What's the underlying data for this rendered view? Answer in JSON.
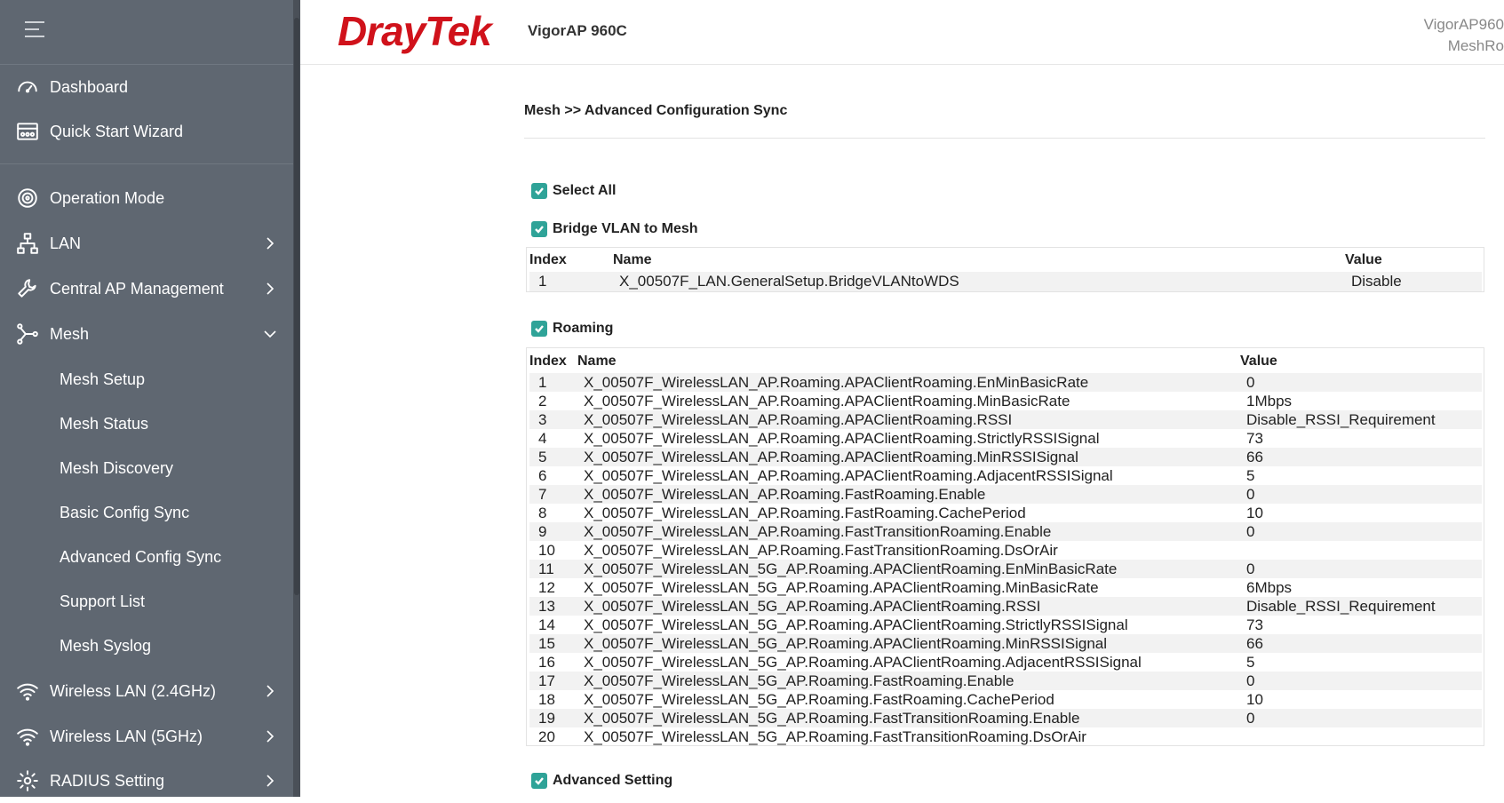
{
  "sidebar": {
    "items": [
      {
        "label": "Dashboard",
        "icon": "gauge-icon"
      },
      {
        "label": "Quick Start Wizard",
        "icon": "wizard-icon"
      },
      {
        "label": "Operation Mode",
        "icon": "operation-mode-icon"
      },
      {
        "label": "LAN",
        "icon": "network-icon"
      },
      {
        "label": "Central AP Management",
        "icon": "wrench-icon"
      },
      {
        "label": "Mesh",
        "icon": "mesh-icon"
      },
      {
        "label": "Wireless LAN (2.4GHz)",
        "icon": "wifi-icon"
      },
      {
        "label": "Wireless LAN (5GHz)",
        "icon": "wifi-icon"
      },
      {
        "label": "RADIUS Setting",
        "icon": "gear-icon"
      }
    ],
    "mesh_sub": [
      "Mesh Setup",
      "Mesh Status",
      "Mesh Discovery",
      "Basic Config Sync",
      "Advanced Config Sync",
      "Support List",
      "Mesh Syslog"
    ]
  },
  "header": {
    "logo": "DrayTek",
    "model": "VigorAP 960C",
    "device_name": "VigorAP960",
    "device_mode": "MeshRo"
  },
  "breadcrumb": "Mesh >> Advanced Configuration Sync",
  "select_all": "Select All",
  "sections": {
    "bridge": {
      "title": "Bridge VLAN to Mesh",
      "headers": [
        "Index",
        "Name",
        "Value"
      ],
      "rows": [
        [
          "1",
          "X_00507F_LAN.GeneralSetup.BridgeVLANtoWDS",
          "Disable"
        ]
      ]
    },
    "roaming": {
      "title": "Roaming",
      "headers": [
        "Index",
        "Name",
        "Value"
      ],
      "rows": [
        [
          "1",
          "X_00507F_WirelessLAN_AP.Roaming.APAClientRoaming.EnMinBasicRate",
          "0"
        ],
        [
          "2",
          "X_00507F_WirelessLAN_AP.Roaming.APAClientRoaming.MinBasicRate",
          "1Mbps"
        ],
        [
          "3",
          "X_00507F_WirelessLAN_AP.Roaming.APAClientRoaming.RSSI",
          "Disable_RSSI_Requirement"
        ],
        [
          "4",
          "X_00507F_WirelessLAN_AP.Roaming.APAClientRoaming.StrictlyRSSISignal",
          "73"
        ],
        [
          "5",
          "X_00507F_WirelessLAN_AP.Roaming.APAClientRoaming.MinRSSISignal",
          "66"
        ],
        [
          "6",
          "X_00507F_WirelessLAN_AP.Roaming.APAClientRoaming.AdjacentRSSISignal",
          "5"
        ],
        [
          "7",
          "X_00507F_WirelessLAN_AP.Roaming.FastRoaming.Enable",
          "0"
        ],
        [
          "8",
          "X_00507F_WirelessLAN_AP.Roaming.FastRoaming.CachePeriod",
          "10"
        ],
        [
          "9",
          "X_00507F_WirelessLAN_AP.Roaming.FastTransitionRoaming.Enable",
          "0"
        ],
        [
          "10",
          "X_00507F_WirelessLAN_AP.Roaming.FastTransitionRoaming.DsOrAir",
          ""
        ],
        [
          "11",
          "X_00507F_WirelessLAN_5G_AP.Roaming.APAClientRoaming.EnMinBasicRate",
          "0"
        ],
        [
          "12",
          "X_00507F_WirelessLAN_5G_AP.Roaming.APAClientRoaming.MinBasicRate",
          "6Mbps"
        ],
        [
          "13",
          "X_00507F_WirelessLAN_5G_AP.Roaming.APAClientRoaming.RSSI",
          "Disable_RSSI_Requirement"
        ],
        [
          "14",
          "X_00507F_WirelessLAN_5G_AP.Roaming.APAClientRoaming.StrictlyRSSISignal",
          "73"
        ],
        [
          "15",
          "X_00507F_WirelessLAN_5G_AP.Roaming.APAClientRoaming.MinRSSISignal",
          "66"
        ],
        [
          "16",
          "X_00507F_WirelessLAN_5G_AP.Roaming.APAClientRoaming.AdjacentRSSISignal",
          "5"
        ],
        [
          "17",
          "X_00507F_WirelessLAN_5G_AP.Roaming.FastRoaming.Enable",
          "0"
        ],
        [
          "18",
          "X_00507F_WirelessLAN_5G_AP.Roaming.FastRoaming.CachePeriod",
          "10"
        ],
        [
          "19",
          "X_00507F_WirelessLAN_5G_AP.Roaming.FastTransitionRoaming.Enable",
          "0"
        ],
        [
          "20",
          "X_00507F_WirelessLAN_5G_AP.Roaming.FastTransitionRoaming.DsOrAir",
          ""
        ]
      ]
    },
    "advanced": {
      "title": "Advanced Setting"
    }
  },
  "colors": {
    "sidebar_bg": "#5f6771",
    "accent": "#2fa398",
    "brand": "#d0121b"
  }
}
